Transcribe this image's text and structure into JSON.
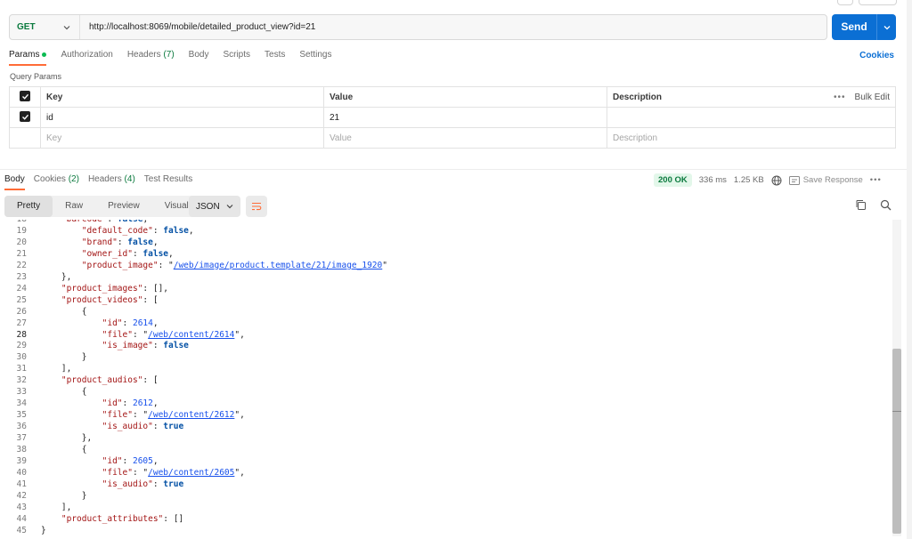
{
  "request": {
    "method": "GET",
    "url": "http://localhost:8069/mobile/detailed_product_view?id=21",
    "send_label": "Send"
  },
  "request_tabs": [
    {
      "label": "Params",
      "active": true,
      "dot": true
    },
    {
      "label": "Authorization"
    },
    {
      "label": "Headers",
      "count": "(7)"
    },
    {
      "label": "Body"
    },
    {
      "label": "Scripts"
    },
    {
      "label": "Tests"
    },
    {
      "label": "Settings"
    }
  ],
  "cookies_link": "Cookies",
  "query_params": {
    "title": "Query Params",
    "headers": {
      "key": "Key",
      "value": "Value",
      "description": "Description",
      "bulk_edit": "Bulk Edit"
    },
    "rows": [
      {
        "key": "id",
        "value": "21",
        "checked": true
      }
    ],
    "placeholders": {
      "key": "Key",
      "value": "Value",
      "description": "Description"
    }
  },
  "response_tabs": [
    {
      "label": "Body",
      "active": true
    },
    {
      "label": "Cookies",
      "count": "(2)"
    },
    {
      "label": "Headers",
      "count": "(4)"
    },
    {
      "label": "Test Results"
    }
  ],
  "response_status": {
    "status": "200 OK",
    "time": "336 ms",
    "size": "1.25 KB",
    "save_response": "Save Response"
  },
  "view_modes": [
    "Pretty",
    "Raw",
    "Preview",
    "Visualize"
  ],
  "active_view_mode": "Pretty",
  "format": "JSON",
  "icons": {
    "globe": "globe-icon",
    "save": "save-icon",
    "copy": "copy-icon",
    "search": "search-icon",
    "wrap": "wrap-lines-icon",
    "more": "more-icon"
  },
  "colors": {
    "accent": "#0b6fd4",
    "success": "#0b7a3e",
    "tab_underline": "#ff6c37"
  },
  "current_line": 28,
  "code_lines": [
    {
      "n": 18,
      "tokens": [
        {
          "t": "    ",
          "c": ""
        },
        {
          "t": "\"barcode\"",
          "c": "k"
        },
        {
          "t": ": ",
          "c": ""
        },
        {
          "t": "false",
          "c": "b"
        },
        {
          "t": ",",
          "c": ""
        }
      ]
    },
    {
      "n": 19,
      "tokens": [
        {
          "t": "        ",
          "c": ""
        },
        {
          "t": "\"default_code\"",
          "c": "k"
        },
        {
          "t": ": ",
          "c": ""
        },
        {
          "t": "false",
          "c": "b"
        },
        {
          "t": ",",
          "c": ""
        }
      ]
    },
    {
      "n": 20,
      "tokens": [
        {
          "t": "        ",
          "c": ""
        },
        {
          "t": "\"brand\"",
          "c": "k"
        },
        {
          "t": ": ",
          "c": ""
        },
        {
          "t": "false",
          "c": "b"
        },
        {
          "t": ",",
          "c": ""
        }
      ]
    },
    {
      "n": 21,
      "tokens": [
        {
          "t": "        ",
          "c": ""
        },
        {
          "t": "\"owner_id\"",
          "c": "k"
        },
        {
          "t": ": ",
          "c": ""
        },
        {
          "t": "false",
          "c": "b"
        },
        {
          "t": ",",
          "c": ""
        }
      ]
    },
    {
      "n": 22,
      "tokens": [
        {
          "t": "        ",
          "c": ""
        },
        {
          "t": "\"product_image\"",
          "c": "k"
        },
        {
          "t": ": \"",
          "c": ""
        },
        {
          "t": "/web/image/product.template/21/image_1920",
          "c": "lnk"
        },
        {
          "t": "\"",
          "c": ""
        }
      ]
    },
    {
      "n": 23,
      "tokens": [
        {
          "t": "    },",
          "c": ""
        }
      ]
    },
    {
      "n": 24,
      "tokens": [
        {
          "t": "    ",
          "c": ""
        },
        {
          "t": "\"product_images\"",
          "c": "k"
        },
        {
          "t": ": [],",
          "c": ""
        }
      ]
    },
    {
      "n": 25,
      "tokens": [
        {
          "t": "    ",
          "c": ""
        },
        {
          "t": "\"product_videos\"",
          "c": "k"
        },
        {
          "t": ": [",
          "c": ""
        }
      ]
    },
    {
      "n": 26,
      "tokens": [
        {
          "t": "        {",
          "c": ""
        }
      ]
    },
    {
      "n": 27,
      "tokens": [
        {
          "t": "            ",
          "c": ""
        },
        {
          "t": "\"id\"",
          "c": "k"
        },
        {
          "t": ": ",
          "c": ""
        },
        {
          "t": "2614",
          "c": "n"
        },
        {
          "t": ",",
          "c": ""
        }
      ]
    },
    {
      "n": 28,
      "tokens": [
        {
          "t": "            ",
          "c": ""
        },
        {
          "t": "\"file\"",
          "c": "k"
        },
        {
          "t": ": \"",
          "c": ""
        },
        {
          "t": "/web/content/2614",
          "c": "lnk"
        },
        {
          "t": "\",",
          "c": ""
        }
      ]
    },
    {
      "n": 29,
      "tokens": [
        {
          "t": "            ",
          "c": ""
        },
        {
          "t": "\"is_image\"",
          "c": "k"
        },
        {
          "t": ": ",
          "c": ""
        },
        {
          "t": "false",
          "c": "b"
        }
      ]
    },
    {
      "n": 30,
      "tokens": [
        {
          "t": "        }",
          "c": ""
        }
      ]
    },
    {
      "n": 31,
      "tokens": [
        {
          "t": "    ],",
          "c": ""
        }
      ]
    },
    {
      "n": 32,
      "tokens": [
        {
          "t": "    ",
          "c": ""
        },
        {
          "t": "\"product_audios\"",
          "c": "k"
        },
        {
          "t": ": [",
          "c": ""
        }
      ]
    },
    {
      "n": 33,
      "tokens": [
        {
          "t": "        {",
          "c": ""
        }
      ]
    },
    {
      "n": 34,
      "tokens": [
        {
          "t": "            ",
          "c": ""
        },
        {
          "t": "\"id\"",
          "c": "k"
        },
        {
          "t": ": ",
          "c": ""
        },
        {
          "t": "2612",
          "c": "n"
        },
        {
          "t": ",",
          "c": ""
        }
      ]
    },
    {
      "n": 35,
      "tokens": [
        {
          "t": "            ",
          "c": ""
        },
        {
          "t": "\"file\"",
          "c": "k"
        },
        {
          "t": ": \"",
          "c": ""
        },
        {
          "t": "/web/content/2612",
          "c": "lnk"
        },
        {
          "t": "\",",
          "c": ""
        }
      ]
    },
    {
      "n": 36,
      "tokens": [
        {
          "t": "            ",
          "c": ""
        },
        {
          "t": "\"is_audio\"",
          "c": "k"
        },
        {
          "t": ": ",
          "c": ""
        },
        {
          "t": "true",
          "c": "b"
        }
      ]
    },
    {
      "n": 37,
      "tokens": [
        {
          "t": "        },",
          "c": ""
        }
      ]
    },
    {
      "n": 38,
      "tokens": [
        {
          "t": "        {",
          "c": ""
        }
      ]
    },
    {
      "n": 39,
      "tokens": [
        {
          "t": "            ",
          "c": ""
        },
        {
          "t": "\"id\"",
          "c": "k"
        },
        {
          "t": ": ",
          "c": ""
        },
        {
          "t": "2605",
          "c": "n"
        },
        {
          "t": ",",
          "c": ""
        }
      ]
    },
    {
      "n": 40,
      "tokens": [
        {
          "t": "            ",
          "c": ""
        },
        {
          "t": "\"file\"",
          "c": "k"
        },
        {
          "t": ": \"",
          "c": ""
        },
        {
          "t": "/web/content/2605",
          "c": "lnk"
        },
        {
          "t": "\",",
          "c": ""
        }
      ]
    },
    {
      "n": 41,
      "tokens": [
        {
          "t": "            ",
          "c": ""
        },
        {
          "t": "\"is_audio\"",
          "c": "k"
        },
        {
          "t": ": ",
          "c": ""
        },
        {
          "t": "true",
          "c": "b"
        }
      ]
    },
    {
      "n": 42,
      "tokens": [
        {
          "t": "        }",
          "c": ""
        }
      ]
    },
    {
      "n": 43,
      "tokens": [
        {
          "t": "    ],",
          "c": ""
        }
      ]
    },
    {
      "n": 44,
      "tokens": [
        {
          "t": "    ",
          "c": ""
        },
        {
          "t": "\"product_attributes\"",
          "c": "k"
        },
        {
          "t": ": []",
          "c": ""
        }
      ]
    },
    {
      "n": 45,
      "tokens": [
        {
          "t": "}",
          "c": ""
        }
      ]
    }
  ]
}
